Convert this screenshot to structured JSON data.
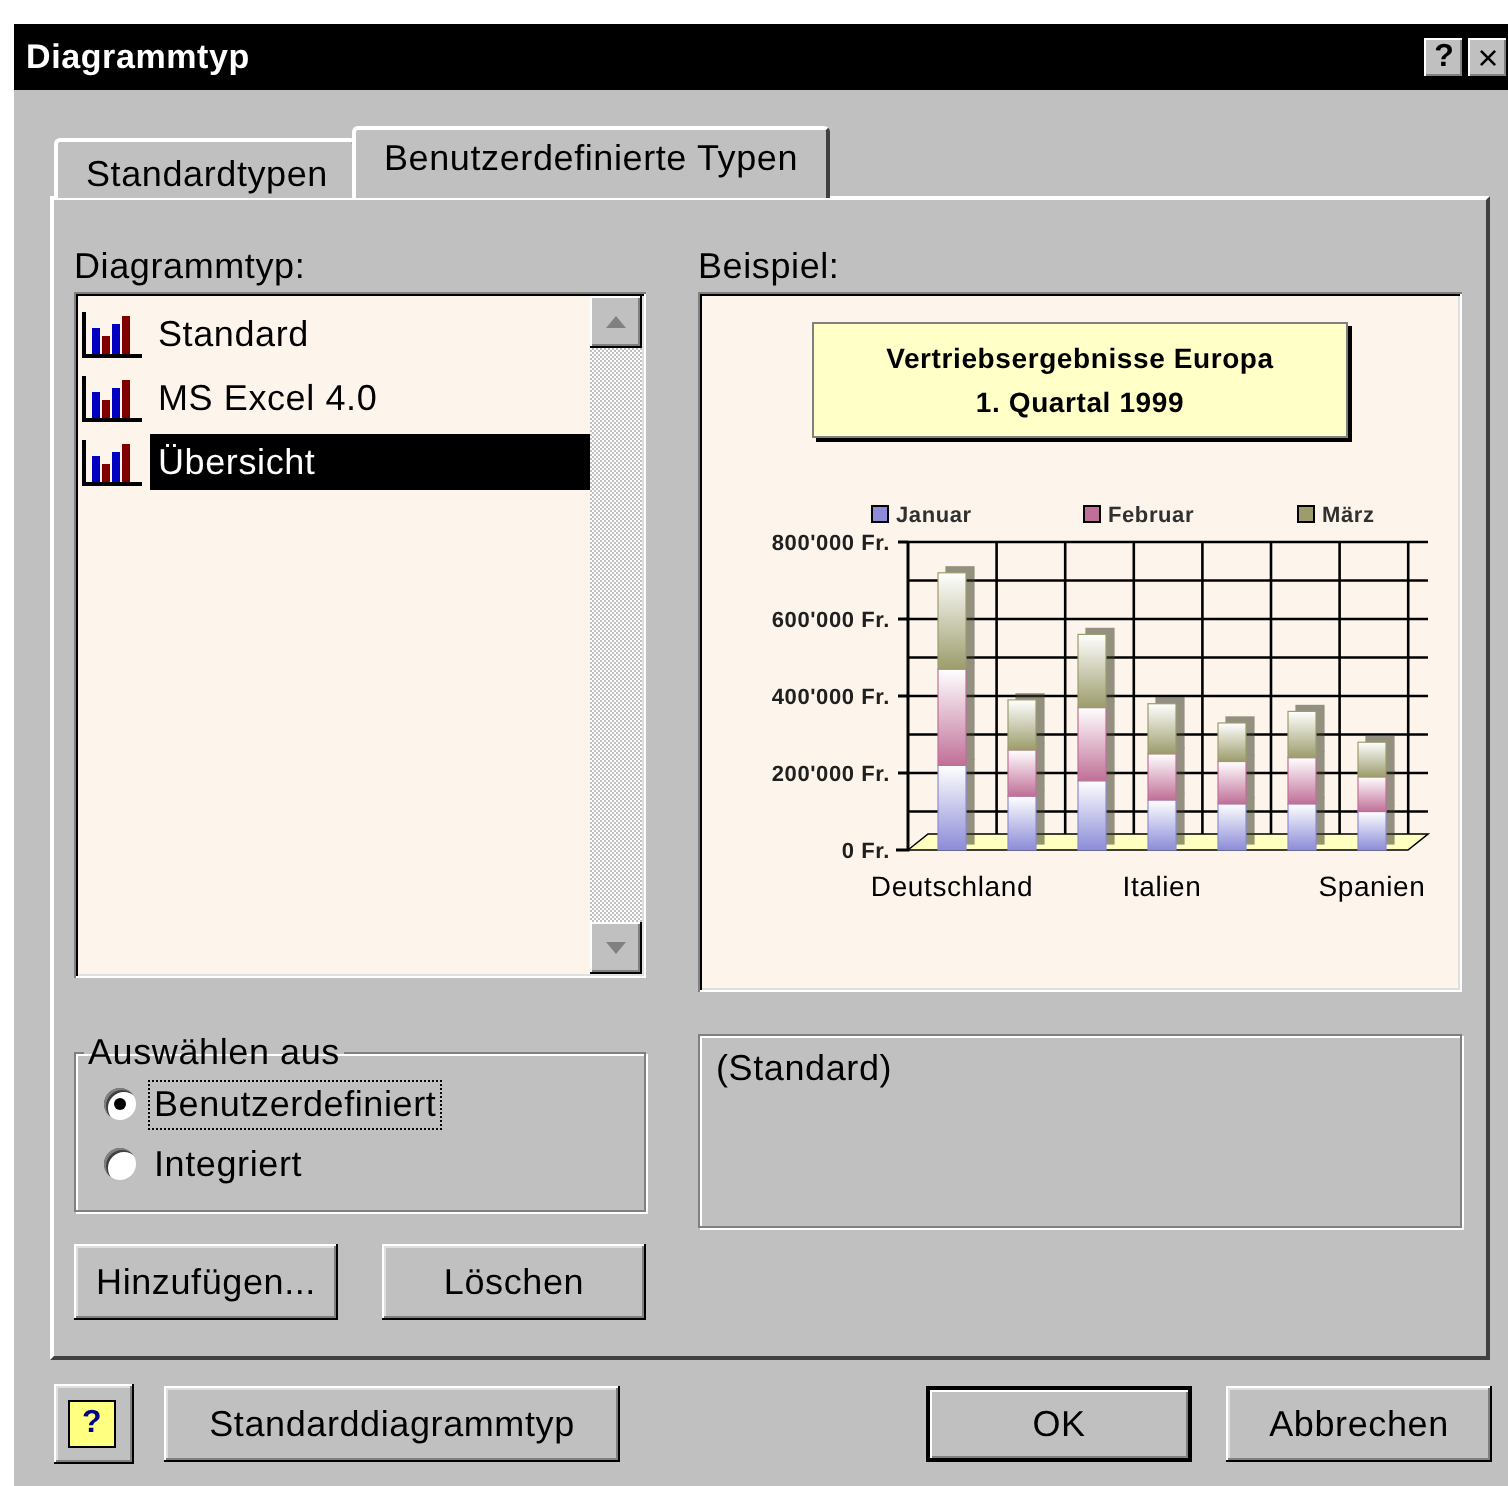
{
  "window": {
    "title": "Diagrammtyp",
    "title_buttons": [
      {
        "kind": "help",
        "label": "?"
      },
      {
        "kind": "close",
        "label": "×"
      }
    ]
  },
  "tabs": [
    {
      "label": "Standardtypen",
      "selected": false
    },
    {
      "label": "Benutzerdefinierte Typen",
      "selected": true
    }
  ],
  "type_list": {
    "label": "Diagrammtyp:",
    "items": [
      {
        "label": "Standard",
        "selected": false
      },
      {
        "label": "MS Excel 4.0",
        "selected": false
      },
      {
        "label": "Übersicht",
        "selected": true
      }
    ]
  },
  "preview": {
    "label": "Beispiel:",
    "chart_data": {
      "type": "bar",
      "stacked": true,
      "orientation": "vertical",
      "title": "Vertriebsergebnisse Europa\n1. Quartal 1999",
      "categories": [
        "Deutschland",
        null,
        null,
        "Italien",
        null,
        null,
        "Spanien"
      ],
      "legend": true,
      "grid": true,
      "ylim": [
        0,
        800000
      ],
      "yticks": [
        {
          "value": 0,
          "label": "0 Fr."
        },
        {
          "value": 200000,
          "label": "200'000 Fr."
        },
        {
          "value": 400000,
          "label": "400'000 Fr."
        },
        {
          "value": 600000,
          "label": "600'000 Fr."
        },
        {
          "value": 800000,
          "label": "800'000 Fr."
        }
      ],
      "series": [
        {
          "name": "Januar",
          "color": "#8c8cd8",
          "values": [
            220000,
            140000,
            180000,
            130000,
            120000,
            120000,
            100000
          ]
        },
        {
          "name": "Februar",
          "color": "#c07098",
          "values": [
            250000,
            120000,
            190000,
            120000,
            110000,
            120000,
            90000
          ]
        },
        {
          "name": "März",
          "color": "#9c9c6c",
          "values": [
            250000,
            130000,
            190000,
            130000,
            100000,
            120000,
            90000
          ]
        }
      ]
    }
  },
  "select_from": {
    "label": "Auswählen aus",
    "options": [
      {
        "label": "Benutzerdefiniert",
        "selected": true
      },
      {
        "label": "Integriert",
        "selected": false
      }
    ]
  },
  "description": "(Standard)",
  "list_buttons": [
    "Hinzufügen...",
    "Löschen"
  ],
  "help_button": "?",
  "footer_buttons": [
    {
      "label": "Standarddiagrammtyp",
      "default": false
    },
    {
      "label": "OK",
      "default": true
    },
    {
      "label": "Abbrechen",
      "default": false
    }
  ]
}
